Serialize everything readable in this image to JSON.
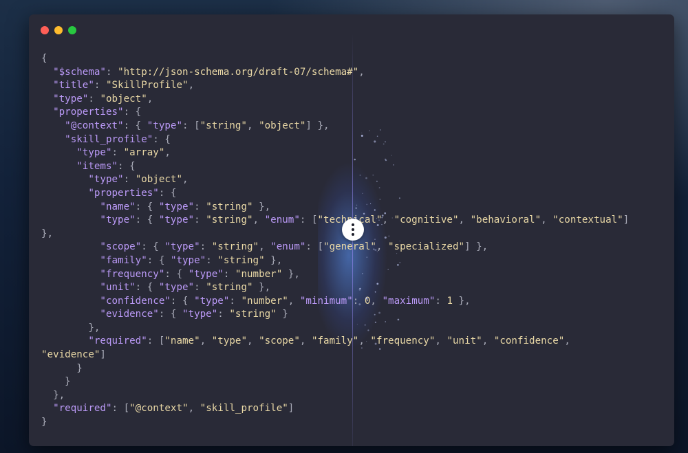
{
  "window": {
    "controls": [
      "close",
      "minimize",
      "maximize"
    ]
  },
  "colors": {
    "key": "#bb9af7",
    "string": "#e9d8a6",
    "punctuation": "#a9abb8",
    "window_bg": "#292a37"
  },
  "divider_handle": {
    "icon": "vertical-ellipsis-icon"
  },
  "code_lines": [
    [
      [
        "p",
        "{"
      ]
    ],
    [
      [
        "p",
        "  "
      ],
      [
        "k",
        "\"$schema\""
      ],
      [
        "p",
        ": "
      ],
      [
        "s",
        "\"http://json-schema.org/draft-07/schema#\""
      ],
      [
        "p",
        ","
      ]
    ],
    [
      [
        "p",
        "  "
      ],
      [
        "k",
        "\"title\""
      ],
      [
        "p",
        ": "
      ],
      [
        "s",
        "\"SkillProfile\""
      ],
      [
        "p",
        ","
      ]
    ],
    [
      [
        "p",
        "  "
      ],
      [
        "k",
        "\"type\""
      ],
      [
        "p",
        ": "
      ],
      [
        "s",
        "\"object\""
      ],
      [
        "p",
        ","
      ]
    ],
    [
      [
        "p",
        "  "
      ],
      [
        "k",
        "\"properties\""
      ],
      [
        "p",
        ": {"
      ]
    ],
    [
      [
        "p",
        "    "
      ],
      [
        "k",
        "\"@context\""
      ],
      [
        "p",
        ": { "
      ],
      [
        "k",
        "\"type\""
      ],
      [
        "p",
        ": ["
      ],
      [
        "s",
        "\"string\""
      ],
      [
        "p",
        ", "
      ],
      [
        "s",
        "\"object\""
      ],
      [
        "p",
        "] },"
      ]
    ],
    [
      [
        "p",
        "    "
      ],
      [
        "k",
        "\"skill_profile\""
      ],
      [
        "p",
        ": {"
      ]
    ],
    [
      [
        "p",
        "      "
      ],
      [
        "k",
        "\"type\""
      ],
      [
        "p",
        ": "
      ],
      [
        "s",
        "\"array\""
      ],
      [
        "p",
        ","
      ]
    ],
    [
      [
        "p",
        "      "
      ],
      [
        "k",
        "\"items\""
      ],
      [
        "p",
        ": {"
      ]
    ],
    [
      [
        "p",
        "        "
      ],
      [
        "k",
        "\"type\""
      ],
      [
        "p",
        ": "
      ],
      [
        "s",
        "\"object\""
      ],
      [
        "p",
        ","
      ]
    ],
    [
      [
        "p",
        "        "
      ],
      [
        "k",
        "\"properties\""
      ],
      [
        "p",
        ": {"
      ]
    ],
    [
      [
        "p",
        "          "
      ],
      [
        "k",
        "\"name\""
      ],
      [
        "p",
        ": { "
      ],
      [
        "k",
        "\"type\""
      ],
      [
        "p",
        ": "
      ],
      [
        "s",
        "\"string\""
      ],
      [
        "p",
        " },"
      ]
    ],
    [
      [
        "p",
        "          "
      ],
      [
        "k",
        "\"type\""
      ],
      [
        "p",
        ": { "
      ],
      [
        "k",
        "\"type\""
      ],
      [
        "p",
        ": "
      ],
      [
        "s",
        "\"string\""
      ],
      [
        "p",
        ", "
      ],
      [
        "k",
        "\"enum\""
      ],
      [
        "p",
        ": ["
      ],
      [
        "s",
        "\"technical\""
      ],
      [
        "p",
        ", "
      ],
      [
        "s",
        "\"cognitive\""
      ],
      [
        "p",
        ", "
      ],
      [
        "s",
        "\"behavioral\""
      ],
      [
        "p",
        ", "
      ],
      [
        "s",
        "\"contextual\""
      ],
      [
        "p",
        "]"
      ]
    ],
    [
      [
        "p",
        "},"
      ]
    ],
    [
      [
        "p",
        "          "
      ],
      [
        "k",
        "\"scope\""
      ],
      [
        "p",
        ": { "
      ],
      [
        "k",
        "\"type\""
      ],
      [
        "p",
        ": "
      ],
      [
        "s",
        "\"string\""
      ],
      [
        "p",
        ", "
      ],
      [
        "k",
        "\"enum\""
      ],
      [
        "p",
        ": ["
      ],
      [
        "s",
        "\"general\""
      ],
      [
        "p",
        ", "
      ],
      [
        "s",
        "\"specialized\""
      ],
      [
        "p",
        "] },"
      ]
    ],
    [
      [
        "p",
        "          "
      ],
      [
        "k",
        "\"family\""
      ],
      [
        "p",
        ": { "
      ],
      [
        "k",
        "\"type\""
      ],
      [
        "p",
        ": "
      ],
      [
        "s",
        "\"string\""
      ],
      [
        "p",
        " },"
      ]
    ],
    [
      [
        "p",
        "          "
      ],
      [
        "k",
        "\"frequency\""
      ],
      [
        "p",
        ": { "
      ],
      [
        "k",
        "\"type\""
      ],
      [
        "p",
        ": "
      ],
      [
        "s",
        "\"number\""
      ],
      [
        "p",
        " },"
      ]
    ],
    [
      [
        "p",
        "          "
      ],
      [
        "k",
        "\"unit\""
      ],
      [
        "p",
        ": { "
      ],
      [
        "k",
        "\"type\""
      ],
      [
        "p",
        ": "
      ],
      [
        "s",
        "\"string\""
      ],
      [
        "p",
        " },"
      ]
    ],
    [
      [
        "p",
        "          "
      ],
      [
        "k",
        "\"confidence\""
      ],
      [
        "p",
        ": { "
      ],
      [
        "k",
        "\"type\""
      ],
      [
        "p",
        ": "
      ],
      [
        "s",
        "\"number\""
      ],
      [
        "p",
        ", "
      ],
      [
        "k",
        "\"minimum\""
      ],
      [
        "p",
        ": "
      ],
      [
        "n",
        "0"
      ],
      [
        "p",
        ", "
      ],
      [
        "k",
        "\"maximum\""
      ],
      [
        "p",
        ": "
      ],
      [
        "n",
        "1"
      ],
      [
        "p",
        " },"
      ]
    ],
    [
      [
        "p",
        "          "
      ],
      [
        "k",
        "\"evidence\""
      ],
      [
        "p",
        ": { "
      ],
      [
        "k",
        "\"type\""
      ],
      [
        "p",
        ": "
      ],
      [
        "s",
        "\"string\""
      ],
      [
        "p",
        " }"
      ]
    ],
    [
      [
        "p",
        "        },"
      ]
    ],
    [
      [
        "p",
        "        "
      ],
      [
        "k",
        "\"required\""
      ],
      [
        "p",
        ": ["
      ],
      [
        "s",
        "\"name\""
      ],
      [
        "p",
        ", "
      ],
      [
        "s",
        "\"type\""
      ],
      [
        "p",
        ", "
      ],
      [
        "s",
        "\"scope\""
      ],
      [
        "p",
        ", "
      ],
      [
        "s",
        "\"family\""
      ],
      [
        "p",
        ", "
      ],
      [
        "s",
        "\"frequency\""
      ],
      [
        "p",
        ", "
      ],
      [
        "s",
        "\"unit\""
      ],
      [
        "p",
        ", "
      ],
      [
        "s",
        "\"confidence\""
      ],
      [
        "p",
        ","
      ]
    ],
    [
      [
        "s",
        "\"evidence\""
      ],
      [
        "p",
        "]"
      ]
    ],
    [
      [
        "p",
        "      }"
      ]
    ],
    [
      [
        "p",
        "    }"
      ]
    ],
    [
      [
        "p",
        "  },"
      ]
    ],
    [
      [
        "p",
        "  "
      ],
      [
        "k",
        "\"required\""
      ],
      [
        "p",
        ": ["
      ],
      [
        "s",
        "\"@context\""
      ],
      [
        "p",
        ", "
      ],
      [
        "s",
        "\"skill_profile\""
      ],
      [
        "p",
        "]"
      ]
    ],
    [
      [
        "p",
        "}"
      ]
    ]
  ]
}
